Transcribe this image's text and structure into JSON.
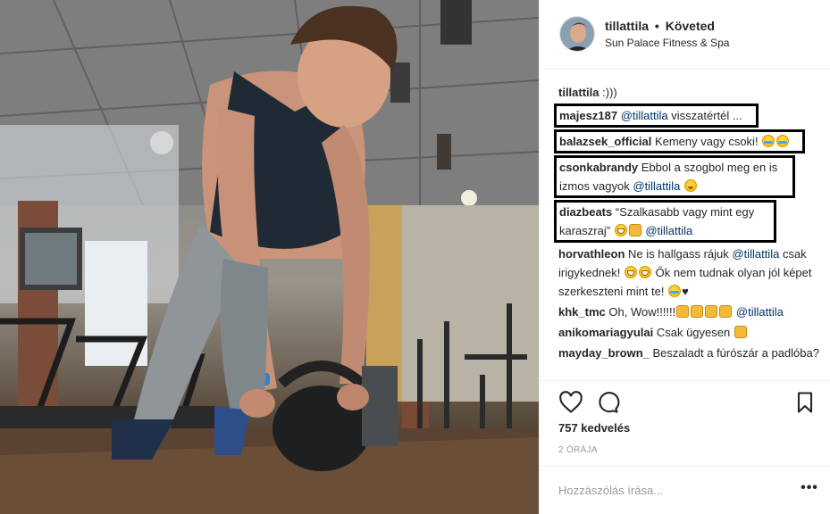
{
  "post": {
    "author": {
      "username": "tillattila",
      "separator": "•",
      "follow_status": "Követed",
      "location": "Sun Palace Fitness & Spa"
    },
    "caption": {
      "user": "tillattila",
      "text": ":)))"
    },
    "comments": [
      {
        "user": "majesz187",
        "mention": "@tillattila",
        "text": "visszatértél ..."
      },
      {
        "user": "balazsek_official",
        "text": "Kemeny vagy csoki!"
      },
      {
        "user": "csonkabrandy",
        "text": "Ebbol a szogbol meg en is izmos vagyok",
        "mention": "@tillattila"
      },
      {
        "user": "diazbeats",
        "text": "“Szalkasabb vagy mint egy karaszraj”",
        "mention": "@tillattila"
      },
      {
        "user": "horvathleon",
        "text_a": "Ne is hallgass rájuk",
        "mention": "@tillattila",
        "text_b": "csak irigykednek!",
        "text_c": "Ők nem tudnak olyan jól képet szerkeszteni mint te!"
      },
      {
        "user": "khk_tmc",
        "text": "Oh, Wow!!!!!!",
        "mention": "@tillattila"
      },
      {
        "user": "anikomariagyulai",
        "text": "Csak ügyesen"
      },
      {
        "user": "mayday_brown_",
        "text": "Beszaladt a fúrószár a padlóba?"
      }
    ],
    "likes_text": "757 kedvelés",
    "time_ago": "2 ÓRÁJA",
    "comment_placeholder": "Hozzászólás írása...",
    "more_label": "•••"
  },
  "icons": [
    "heart-icon",
    "comment-icon",
    "bookmark-icon"
  ],
  "colors": {
    "mention": "#003569",
    "text": "#262626",
    "muted": "#999999",
    "border": "#efefef"
  }
}
